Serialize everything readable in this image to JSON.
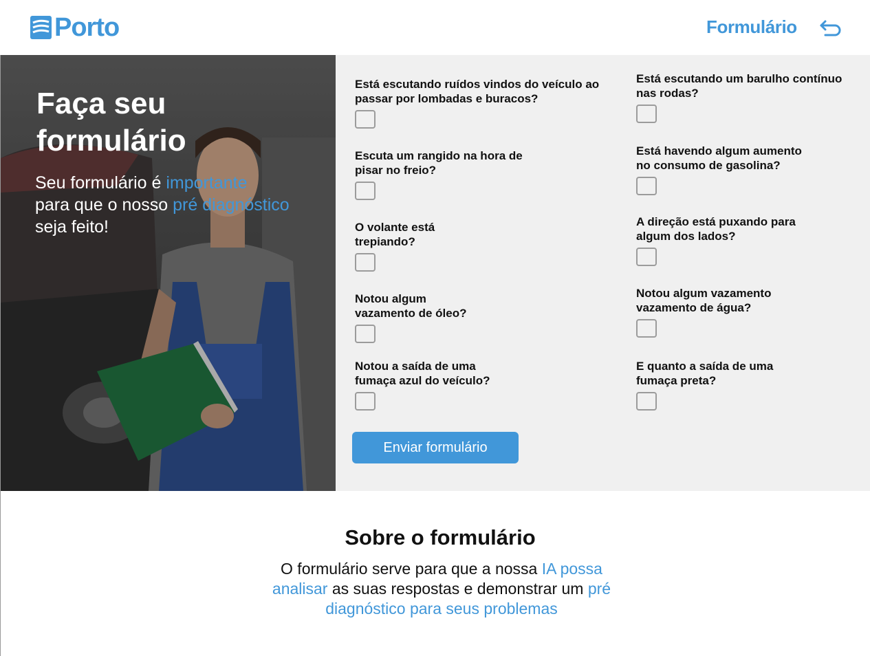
{
  "header": {
    "logo_text": "Porto",
    "nav_title": "Formulário",
    "back_icon": "return-arrow-icon"
  },
  "hero": {
    "title_line1": "Faça seu",
    "title_line2": "formulário",
    "subtitle": {
      "p1": "Seu formulário é ",
      "h1": "importante",
      "p2": "para que o nosso ",
      "h2": "pré diagnóstico",
      "p3": " seja feito!"
    },
    "image": "mechanic-holding-folder-photo"
  },
  "form": {
    "left_questions": [
      "Está escutando ruídos vindos do veículo ao passar por lombadas e buracos?",
      "Escuta um rangido na hora de pisar no freio?",
      "O volante está trepiando?",
      "Notou algum vazamento de óleo?",
      "Notou a saída de uma fumaça azul do veículo?"
    ],
    "right_questions": [
      "Está escutando um barulho contínuo nas rodas?",
      "Está havendo algum aumento no consumo de gasolina?",
      "A direção está puxando para algum dos lados?",
      "Notou algum vazamento vazamento de água?",
      "E quanto a saída de uma fumaça preta?"
    ],
    "submit_label": "Enviar formulário"
  },
  "about": {
    "title": "Sobre o formulário",
    "t1": "O  formulário serve para que a nossa ",
    "h1": "IA possa analisar",
    "t2": " as suas respostas e demonstrar um ",
    "h2": "pré diagnóstico para seus problemas"
  },
  "colors": {
    "accent": "#4197d9",
    "panel_bg": "#f0f0f0",
    "checkbox_border": "#9b9b9b"
  }
}
